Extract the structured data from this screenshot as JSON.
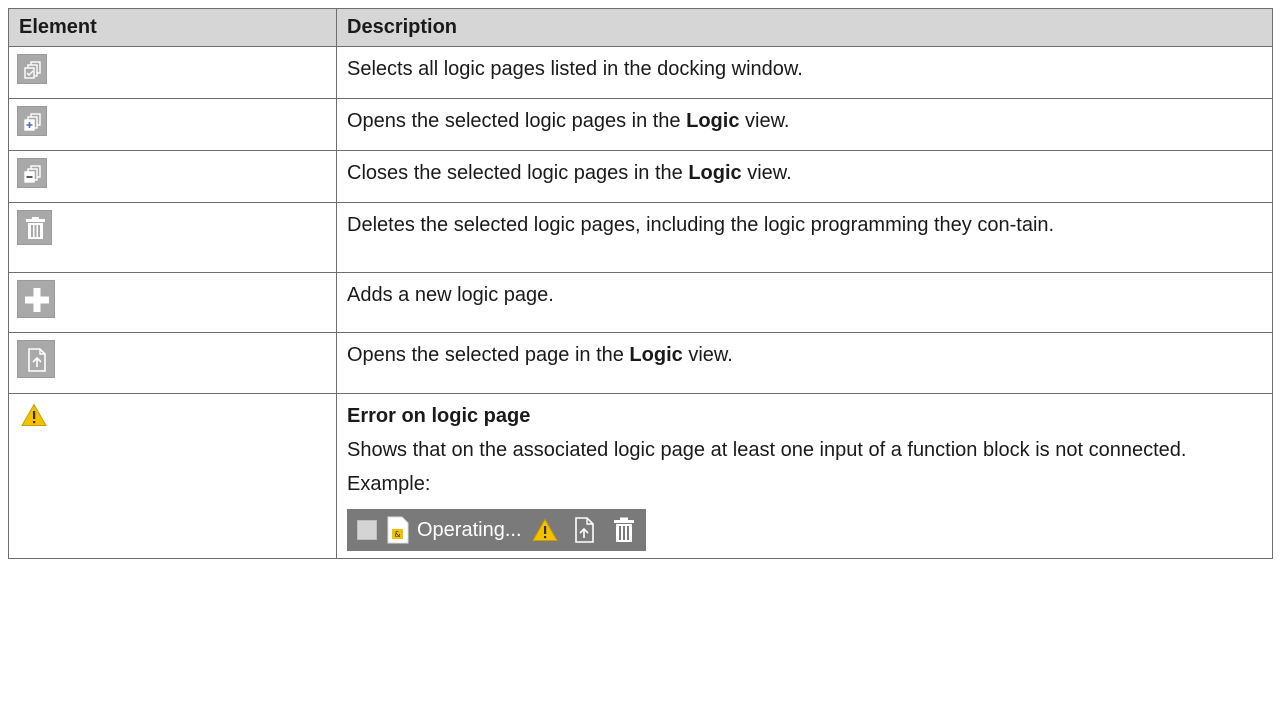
{
  "header": {
    "col_element": "Element",
    "col_description": "Description"
  },
  "rows": [
    {
      "icon": "select-all-pages-icon",
      "text": "Selects all logic pages listed in the docking window."
    },
    {
      "icon": "open-pages-icon",
      "text_before": "Opens the selected logic pages in the ",
      "bold": "Logic",
      "text_after": " view."
    },
    {
      "icon": "close-pages-icon",
      "text_before": "Closes the selected logic pages in the ",
      "bold": "Logic",
      "text_after": " view."
    },
    {
      "icon": "trash-icon",
      "text": "Deletes the selected logic pages, including the logic programming they con-tain."
    },
    {
      "icon": "plus-icon",
      "text": "Adds a new logic page."
    },
    {
      "icon": "open-page-icon",
      "text_before": "Opens the selected page in the ",
      "bold": "Logic",
      "text_after": " view."
    },
    {
      "icon": "warning-icon",
      "title": "Error on logic page",
      "text": "Shows that on the associated logic page at least one input of a function block is not connected.",
      "example_label": "Example:",
      "example": {
        "page_label": "Operating..."
      }
    }
  ],
  "colors": {
    "header_bg": "#d6d6d6",
    "border": "#6e6e6e",
    "icon_bg": "#a9a9a9",
    "example_bg": "#7a7a7a",
    "warning": "#f2c200"
  }
}
